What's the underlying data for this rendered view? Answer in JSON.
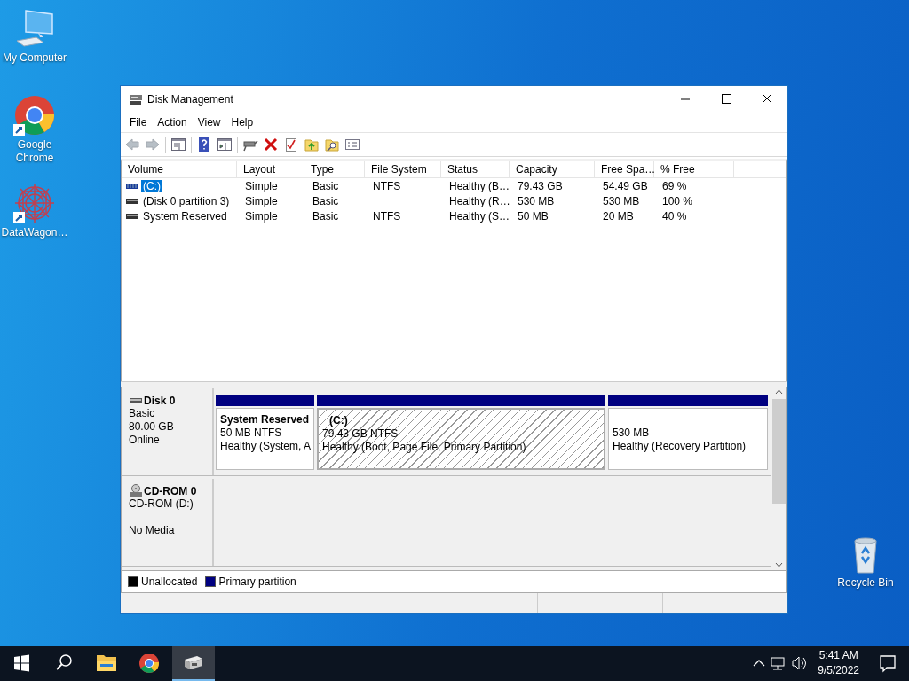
{
  "desktop_icons": [
    {
      "label": "My Computer",
      "kind": "computer",
      "shortcut": false
    },
    {
      "label": "Google Chrome",
      "kind": "chrome",
      "shortcut": true
    },
    {
      "label": "DataWagon…",
      "kind": "app",
      "shortcut": true
    },
    {
      "label": "Recycle Bin",
      "kind": "recycle",
      "shortcut": false
    }
  ],
  "window": {
    "title": "Disk Management",
    "menu": [
      "File",
      "Action",
      "View",
      "Help"
    ],
    "toolbar": [
      {
        "kind": "back",
        "disabled": true
      },
      {
        "kind": "forward",
        "disabled": true
      },
      {
        "kind": "separator"
      },
      {
        "kind": "console",
        "disabled": false
      },
      {
        "kind": "separator"
      },
      {
        "kind": "help",
        "disabled": false
      },
      {
        "kind": "pane",
        "disabled": false
      },
      {
        "kind": "separator"
      },
      {
        "kind": "connect",
        "disabled": false
      },
      {
        "kind": "delete",
        "disabled": false
      },
      {
        "kind": "check",
        "disabled": false
      },
      {
        "kind": "folder-up",
        "disabled": false
      },
      {
        "kind": "folder-search",
        "disabled": false
      },
      {
        "kind": "list",
        "disabled": false
      }
    ],
    "volumes": {
      "columns": [
        "Volume",
        "Layout",
        "Type",
        "File System",
        "Status",
        "Capacity",
        "Free Spa…",
        "% Free"
      ],
      "rows": [
        {
          "selected": true,
          "kind": "striped",
          "cells": [
            "(C:)",
            "Simple",
            "Basic",
            "NTFS",
            "Healthy (B…",
            "79.43 GB",
            "54.49 GB",
            "69 %"
          ]
        },
        {
          "selected": false,
          "kind": "plain",
          "cells": [
            "(Disk 0 partition 3)",
            "Simple",
            "Basic",
            "",
            "Healthy (R…",
            "530 MB",
            "530 MB",
            "100 %"
          ]
        },
        {
          "selected": false,
          "kind": "plain",
          "cells": [
            "System Reserved",
            "Simple",
            "Basic",
            "NTFS",
            "Healthy (S…",
            "50 MB",
            "20 MB",
            "40 %"
          ]
        }
      ]
    },
    "disks": [
      {
        "kind": "disk",
        "name": "Disk 0",
        "lines": [
          "Basic",
          "80.00 GB"
        ],
        "state": "Online",
        "partitions": [
          {
            "label": "System Reserved",
            "size": "50 MB NTFS",
            "status": "Healthy (System, A",
            "hatched": false
          },
          {
            "label": "(C:)",
            "size": "79.43 GB NTFS",
            "status": "Healthy (Boot, Page File, Primary Partition)",
            "hatched": true
          },
          {
            "size": "530 MB",
            "status": "Healthy (Recovery Partition)",
            "hatched": false
          }
        ]
      },
      {
        "kind": "cdrom",
        "name": "CD-ROM 0",
        "lines": [
          "CD-ROM (D:)"
        ],
        "state": "No Media"
      }
    ],
    "legend": [
      {
        "label": "Unallocated",
        "color": "#000000"
      },
      {
        "label": "Primary partition",
        "color": "#000080"
      }
    ]
  },
  "taskbar": {
    "apps": [
      {
        "kind": "explorer",
        "active": false
      },
      {
        "kind": "chrome",
        "active": false
      },
      {
        "kind": "disk-management",
        "active": true
      }
    ],
    "time": "5:41 AM",
    "date": "9/5/2022"
  }
}
